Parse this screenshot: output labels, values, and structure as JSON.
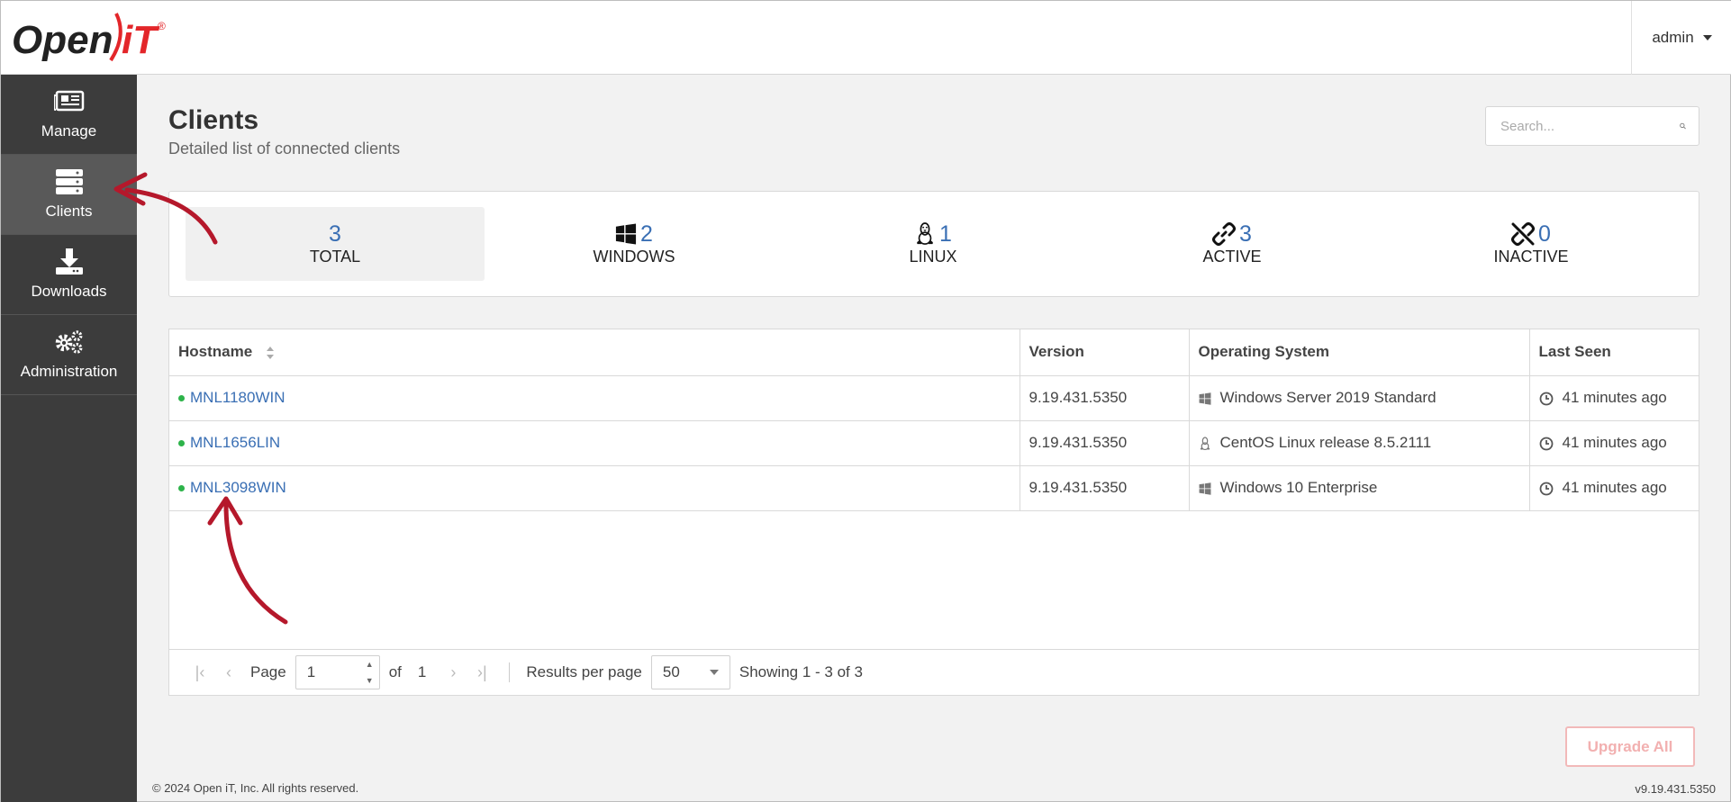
{
  "brand": {
    "logo_text_main": "Open",
    "logo_text_accent": "iT",
    "registered": "®"
  },
  "user": {
    "name": "admin"
  },
  "sidebar": {
    "items": [
      {
        "label": "Manage",
        "icon": "newspaper-icon",
        "active": false
      },
      {
        "label": "Clients",
        "icon": "server-icon",
        "active": true
      },
      {
        "label": "Downloads",
        "icon": "download-icon",
        "active": false
      },
      {
        "label": "Administration",
        "icon": "gears-icon",
        "active": false
      }
    ]
  },
  "page": {
    "title": "Clients",
    "subtitle": "Detailed list of connected clients"
  },
  "search": {
    "placeholder": "Search..."
  },
  "stats": [
    {
      "value": "3",
      "label": "TOTAL",
      "icon": "",
      "selected": true
    },
    {
      "value": "2",
      "label": "WINDOWS",
      "icon": "windows-icon",
      "selected": false
    },
    {
      "value": "1",
      "label": "LINUX",
      "icon": "linux-icon",
      "selected": false
    },
    {
      "value": "3",
      "label": "ACTIVE",
      "icon": "link-icon",
      "selected": false
    },
    {
      "value": "0",
      "label": "INACTIVE",
      "icon": "unlink-icon",
      "selected": false
    }
  ],
  "table": {
    "headers": {
      "hostname": "Hostname",
      "version": "Version",
      "os": "Operating System",
      "last_seen": "Last Seen"
    },
    "rows": [
      {
        "hostname": "MNL1180WIN",
        "version": "9.19.431.5350",
        "os": "Windows Server 2019 Standard",
        "os_icon": "windows-icon",
        "last_seen": "41 minutes ago",
        "status_color": "#2db34a"
      },
      {
        "hostname": "MNL1656LIN",
        "version": "9.19.431.5350",
        "os": "CentOS Linux release 8.5.2111",
        "os_icon": "linux-icon",
        "last_seen": "41 minutes ago",
        "status_color": "#2db34a"
      },
      {
        "hostname": "MNL3098WIN",
        "version": "9.19.431.5350",
        "os": "Windows 10 Enterprise",
        "os_icon": "windows-icon",
        "last_seen": "41 minutes ago",
        "status_color": "#2db34a"
      }
    ]
  },
  "pager": {
    "page_label": "Page",
    "current_page": "1",
    "of_label": "of",
    "total_pages": "1",
    "results_label": "Results per page",
    "per_page": "50",
    "showing": "Showing 1 - 3 of 3"
  },
  "actions": {
    "upgrade_all": "Upgrade All"
  },
  "footer": {
    "copyright": "© 2024 Open iT, Inc. All rights reserved.",
    "version": "v9.19.431.5350"
  },
  "colors": {
    "accent": "#3a6fb4",
    "logo_red": "#e3262a",
    "annotation_arrow": "#b5182b",
    "sidebar_bg": "#3c3c3c",
    "sidebar_active": "#595959"
  }
}
